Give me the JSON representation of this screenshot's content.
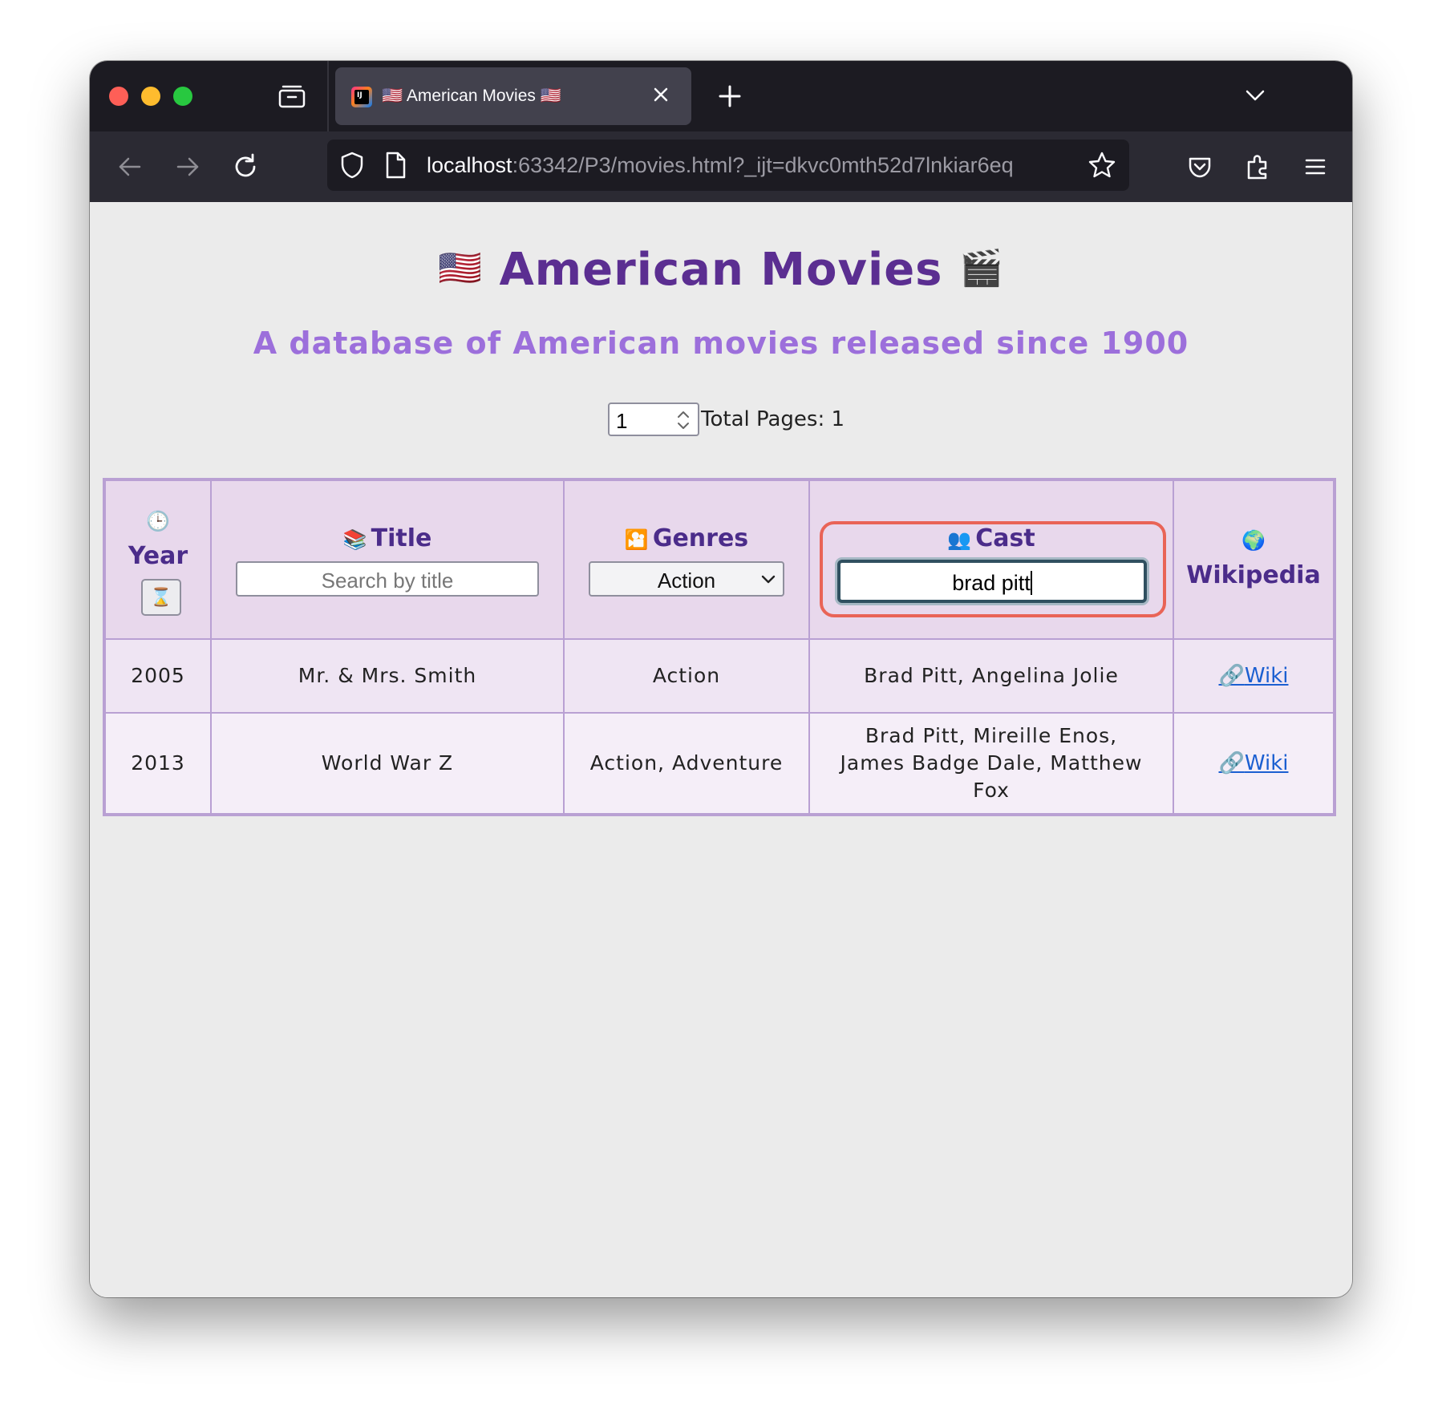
{
  "browser": {
    "tab_title": "🇺🇸 American Movies 🇺🇸",
    "url_host": "localhost",
    "url_rest": ":63342/P3/movies.html?_ijt=dkvc0mth52d7lnkiar6eq",
    "favicon_text": "IJ"
  },
  "page": {
    "title": "American Movies",
    "title_flag": "🇺🇸",
    "title_clapper": "🎬",
    "subtitle": "A database of American movies released since 1900",
    "page_number": "1",
    "total_pages_label": "Total Pages: 1"
  },
  "table": {
    "headers": {
      "year": {
        "icon": "🕒",
        "label": "Year",
        "sort_icon": "⌛"
      },
      "title": {
        "icon": "📚",
        "label": "Title",
        "placeholder": "Search by title"
      },
      "genres": {
        "icon": "🎦",
        "label": "Genres",
        "selected": "Action"
      },
      "cast": {
        "icon": "👥",
        "label": "Cast",
        "value": "brad pitt"
      },
      "wikipedia": {
        "icon": "🌍",
        "label": "Wikipedia"
      }
    },
    "rows": [
      {
        "year": "2005",
        "title": "Mr. & Mrs. Smith",
        "genres": "Action",
        "cast": "Brad Pitt, Angelina Jolie",
        "wiki_icon": "🔗",
        "wiki": "Wiki"
      },
      {
        "year": "2013",
        "title": "World War Z",
        "genres": "Action, Adventure",
        "cast": "Brad Pitt, Mireille Enos, James Badge Dale, Matthew Fox",
        "wiki_icon": "🔗",
        "wiki": "Wiki"
      }
    ]
  },
  "colors": {
    "heading": "#5b2e91",
    "subheading": "#9c6fdb",
    "table_border": "#b9a0d3",
    "highlight": "#e96457",
    "link": "#1b5fd1"
  }
}
